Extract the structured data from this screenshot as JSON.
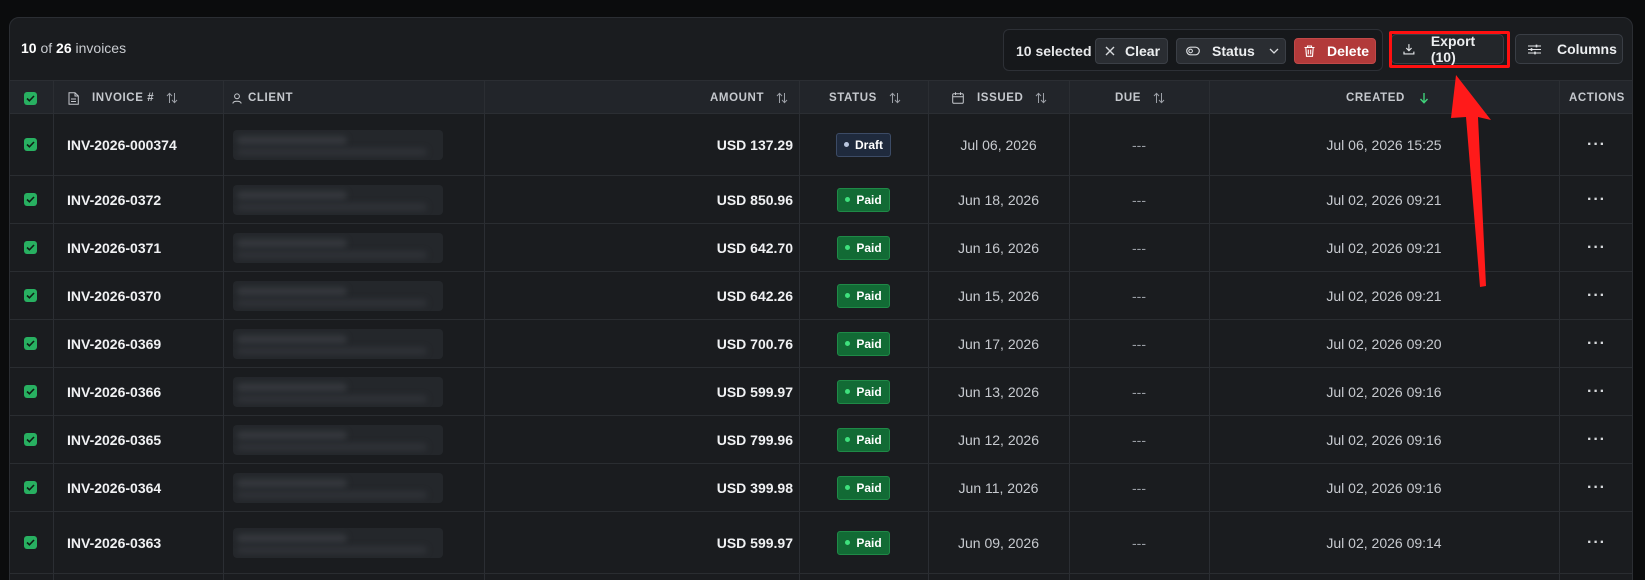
{
  "toolbar": {
    "count_shown": "10",
    "count_of": "of",
    "count_total": "26",
    "count_suffix": "invoices",
    "selected_label": "10 selected",
    "clear_label": "Clear",
    "status_label": "Status",
    "delete_label": "Delete",
    "export_label": "Export (10)",
    "columns_label": "Columns"
  },
  "columns": {
    "invoice": "INVOICE #",
    "client": "CLIENT",
    "amount": "AMOUNT",
    "status": "STATUS",
    "issued": "ISSUED",
    "due": "DUE",
    "created": "CREATED",
    "actions": "ACTIONS"
  },
  "rows": [
    {
      "invoice": "INV-2026-000374",
      "amount": "USD 137.29",
      "status": "Draft",
      "issued": "Jul 06, 2026",
      "due": "---",
      "created": "Jul 06, 2026 15:25"
    },
    {
      "invoice": "INV-2026-0372",
      "amount": "USD 850.96",
      "status": "Paid",
      "issued": "Jun 18, 2026",
      "due": "---",
      "created": "Jul 02, 2026 09:21"
    },
    {
      "invoice": "INV-2026-0371",
      "amount": "USD 642.70",
      "status": "Paid",
      "issued": "Jun 16, 2026",
      "due": "---",
      "created": "Jul 02, 2026 09:21"
    },
    {
      "invoice": "INV-2026-0370",
      "amount": "USD 642.26",
      "status": "Paid",
      "issued": "Jun 15, 2026",
      "due": "---",
      "created": "Jul 02, 2026 09:21"
    },
    {
      "invoice": "INV-2026-0369",
      "amount": "USD 700.76",
      "status": "Paid",
      "issued": "Jun 17, 2026",
      "due": "---",
      "created": "Jul 02, 2026 09:20"
    },
    {
      "invoice": "INV-2026-0366",
      "amount": "USD 599.97",
      "status": "Paid",
      "issued": "Jun 13, 2026",
      "due": "---",
      "created": "Jul 02, 2026 09:16"
    },
    {
      "invoice": "INV-2026-0365",
      "amount": "USD 799.96",
      "status": "Paid",
      "issued": "Jun 12, 2026",
      "due": "---",
      "created": "Jul 02, 2026 09:16"
    },
    {
      "invoice": "INV-2026-0364",
      "amount": "USD 399.98",
      "status": "Paid",
      "issued": "Jun 11, 2026",
      "due": "---",
      "created": "Jul 02, 2026 09:16"
    },
    {
      "invoice": "INV-2026-0363",
      "amount": "USD 599.97",
      "status": "Paid",
      "issued": "Jun 09, 2026",
      "due": "---",
      "created": "Jul 02, 2026 09:14"
    }
  ],
  "row_actions_label": "···",
  "colors": {
    "panel_bg": "#1a1c1f",
    "header_bg": "#22252a",
    "checkbox": "#28b061",
    "paid_badge": "#126b35",
    "draft_badge": "#1f2a3d",
    "delete_button": "#b23a3a",
    "sort_active": "#3fd17a",
    "annotation": "#ff1010"
  }
}
